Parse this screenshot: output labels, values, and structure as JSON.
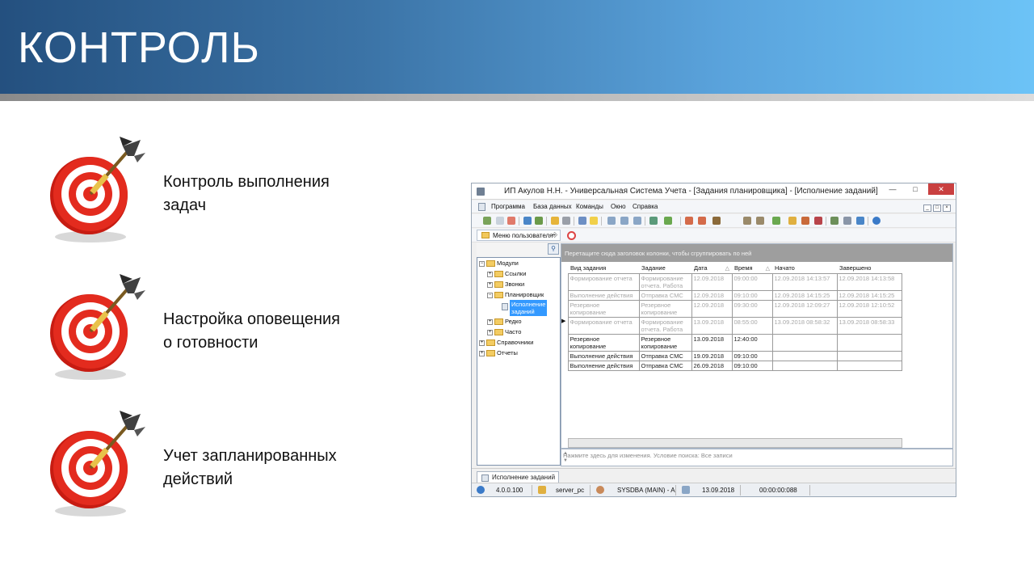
{
  "slide": {
    "title": "КОНТРОЛЬ",
    "bullets": [
      {
        "line1": "Контроль выполнения",
        "line2": "задач"
      },
      {
        "line1": "Настройка оповещения",
        "line2": "о готовности"
      },
      {
        "line1": "Учет запланированных",
        "line2": "действий"
      }
    ]
  },
  "colors": {
    "banner_start": "#24507f",
    "banner_end": "#6cc3f7",
    "target_red": "#e0261b",
    "selection_blue": "#3399ff"
  },
  "window": {
    "title": "ИП Акулов Н.Н. - Универсальная Система Учета - [Задания планировщика] - [Исполнение заданий]",
    "menu": [
      "Программа",
      "База данных",
      "Команды",
      "Окно",
      "Справка"
    ],
    "left_panel": {
      "header": "Меню пользователя",
      "tree": {
        "modules": "Модули",
        "links": "Ссылки",
        "calls": "Звонки",
        "scheduler": "Планировщик",
        "execution_line1": "Исполнение",
        "execution_line2": "заданий",
        "rarely": "Редко",
        "often": "Часто",
        "references": "Справочники",
        "reports": "Отчеты"
      }
    },
    "grid": {
      "group_hint": "Перетащите сюда заголовок колонки, чтобы сгруппировать по ней",
      "columns": [
        "Вид задания",
        "Задание",
        "Дата",
        "Время",
        "Начато",
        "Завершено"
      ],
      "rows": [
        {
          "kind": "Формирование отчета",
          "task1": "Формирование",
          "task2": "отчета. Работа",
          "date": "12.09.2018",
          "time": "09:00:00",
          "started": "12.09.2018 14:13:57",
          "finished": "12.09.2018 14:13:58",
          "dim": true
        },
        {
          "kind": "Выполнение действия",
          "task1": "Отправка СМС",
          "task2": "",
          "date": "12.09.2018",
          "time": "09:10:00",
          "started": "12.09.2018 14:15:25",
          "finished": "12.09.2018 14:15:25",
          "dim": true
        },
        {
          "kind": "Резервное копирование",
          "task1": "Резервное",
          "task2": "копирование",
          "date": "12.09.2018",
          "time": "09:30:00",
          "started": "12.09.2018 12:09:27",
          "finished": "12.09.2018 12:10:52",
          "dim": true
        },
        {
          "kind": "Формирование отчета",
          "task1": "Формирование",
          "task2": "отчета. Работа",
          "date": "13.09.2018",
          "time": "08:55:00",
          "started": "13.09.2018 08:58:32",
          "finished": "13.09.2018 08:58:33",
          "dim": true
        },
        {
          "kind": "Резервное копирование",
          "task1": "Резервное",
          "task2": "копирование",
          "date": "13.09.2018",
          "time": "12:40:00",
          "started": "",
          "finished": "",
          "dim": false
        },
        {
          "kind": "Выполнение действия",
          "task1": "Отправка СМС",
          "task2": "",
          "date": "19.09.2018",
          "time": "09:10:00",
          "started": "",
          "finished": "",
          "dim": false
        },
        {
          "kind": "Выполнение действия",
          "task1": "Отправка СМС",
          "task2": "",
          "date": "26.09.2018",
          "time": "09:10:00",
          "started": "",
          "finished": "",
          "dim": false
        }
      ],
      "filter_hint": "Нажмите здесь для изменения. Условие поиска: Все записи"
    },
    "tab": "Исполнение заданий",
    "status": {
      "version": "4.0.0.100",
      "server": "server_pc",
      "user": "SYSDBA (MAIN) - A",
      "date": "13.09.2018",
      "timer": "00:00:00:088"
    }
  }
}
